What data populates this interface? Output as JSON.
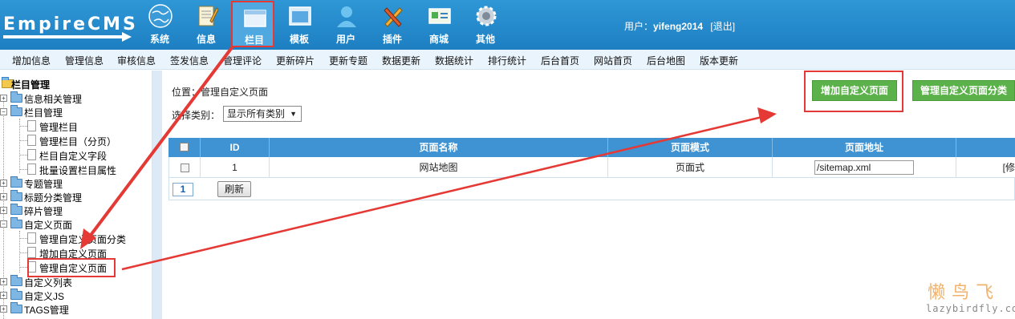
{
  "header": {
    "logo": "EmpireCMS",
    "nav": [
      {
        "label": "系统",
        "icon": "globe-icon"
      },
      {
        "label": "信息",
        "icon": "notepad-icon"
      },
      {
        "label": "栏目",
        "icon": "window-icon"
      },
      {
        "label": "模板",
        "icon": "template-icon"
      },
      {
        "label": "用户",
        "icon": "user-icon"
      },
      {
        "label": "插件",
        "icon": "tools-icon"
      },
      {
        "label": "商城",
        "icon": "card-icon"
      },
      {
        "label": "其他",
        "icon": "gear-icon"
      }
    ],
    "active_nav": "栏目",
    "user_prefix": "用户：",
    "username": "yifeng2014",
    "logout": "[退出]"
  },
  "menu": [
    "增加信息",
    "管理信息",
    "审核信息",
    "签发信息",
    "管理评论",
    "更新碎片",
    "更新专题",
    "数据更新",
    "数据统计",
    "排行统计",
    "后台首页",
    "网站首页",
    "后台地图",
    "版本更新"
  ],
  "sidebar": {
    "root": "栏目管理",
    "nodes": [
      {
        "label": "信息相关管理"
      },
      {
        "label": "栏目管理"
      },
      {
        "label": "管理栏目"
      },
      {
        "label": "管理栏目（分页）"
      },
      {
        "label": "栏目自定义字段"
      },
      {
        "label": "批量设置栏目属性"
      },
      {
        "label": "专题管理"
      },
      {
        "label": "标题分类管理"
      },
      {
        "label": "碎片管理"
      },
      {
        "label": "自定义页面"
      },
      {
        "label": "管理自定义页面分类"
      },
      {
        "label": "增加自定义页面"
      },
      {
        "label": "管理自定义页面"
      },
      {
        "label": "自定义列表"
      },
      {
        "label": "自定义JS"
      },
      {
        "label": "TAGS管理"
      }
    ]
  },
  "main": {
    "position_label": "位置：",
    "position_value": "管理自定义页面",
    "category_label": "选择类别：",
    "category_value": "显示所有类别",
    "buttons": {
      "add": "增加自定义页面",
      "manage_class": "管理自定义页面分类"
    },
    "table": {
      "columns": [
        "",
        "ID",
        "页面名称",
        "页面模式",
        "页面地址",
        ""
      ],
      "rows": [
        {
          "id": "1",
          "name": "网站地图",
          "mode": "页面式",
          "url": "/sitemap.xml",
          "action": "[修"
        }
      ]
    },
    "page": "1",
    "refresh": "刷新"
  },
  "watermark": {
    "logo": "懒鸟飞",
    "site": "lazybirdfly.com"
  },
  "colors": {
    "header": "#1d7fc2",
    "table_head": "#3f93d2",
    "green_button": "#5cb24a",
    "highlight": "#e53935"
  }
}
